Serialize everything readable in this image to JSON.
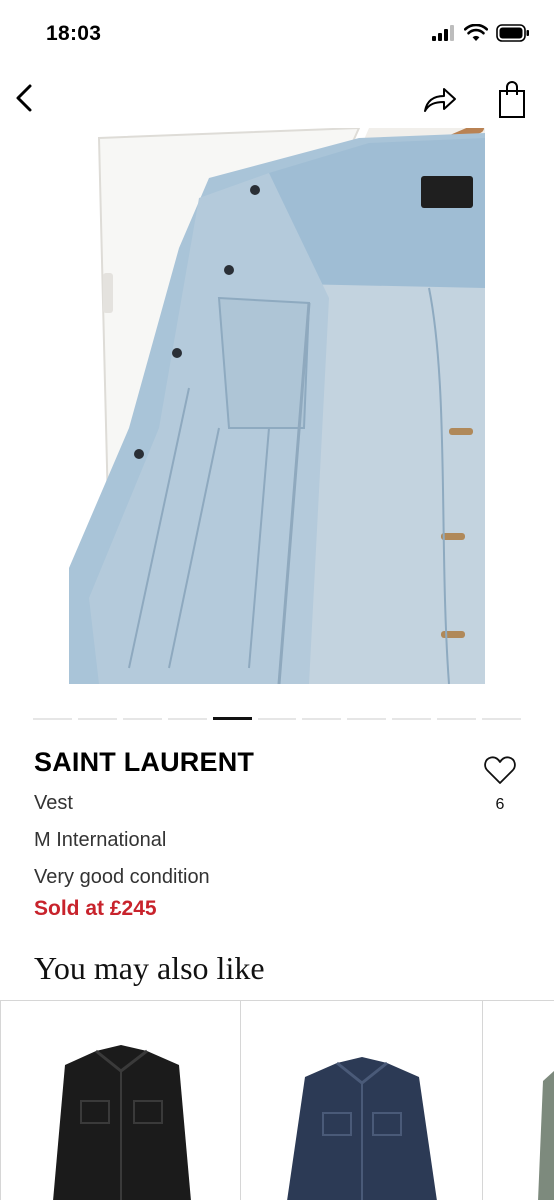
{
  "status_bar": {
    "time": "18:03"
  },
  "product": {
    "brand": "SAINT LAURENT",
    "type": "Vest",
    "size": "M International",
    "condition": "Very good condition",
    "sold": "Sold at £245",
    "likes": "6"
  },
  "gallery": {
    "total_images": 11,
    "active_index": 4
  },
  "related": {
    "title": "You may also like"
  },
  "colors": {
    "sold_red": "#c8232c",
    "denim_light": "#a9c4d8",
    "denim_dark": "#2c3a55"
  }
}
